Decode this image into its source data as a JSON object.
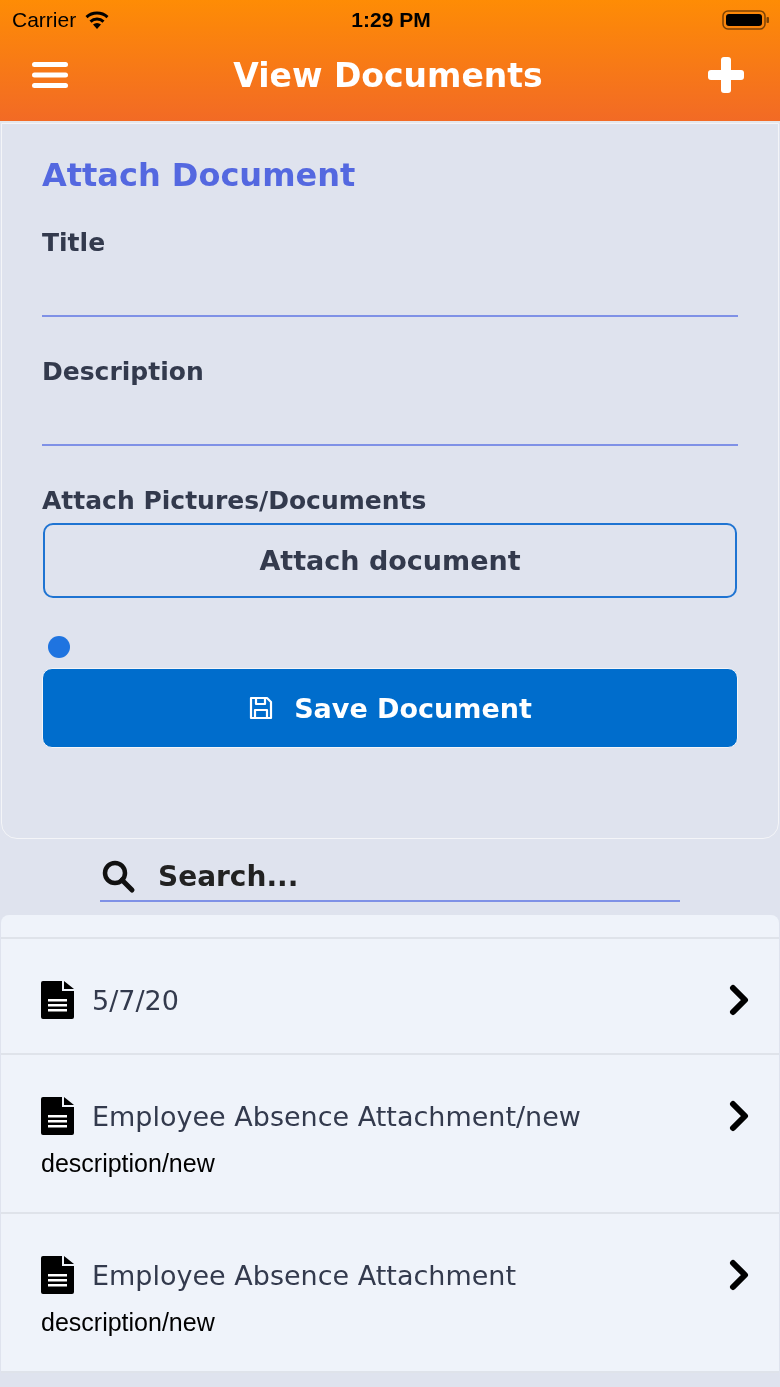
{
  "status_bar": {
    "carrier": "Carrier",
    "time": "1:29 PM"
  },
  "header": {
    "title": "View Documents"
  },
  "form": {
    "heading": "Attach Document",
    "fields": [
      {
        "label": "Title"
      },
      {
        "label": "Description"
      }
    ],
    "attach_label": "Attach Pictures/Documents",
    "attach_button": "Attach document",
    "save_button": "Save Document"
  },
  "search": {
    "placeholder": "Search..."
  },
  "documents": [
    {
      "title": "5/7/20"
    },
    {
      "title": "Employee Absence Attachment/new",
      "description": "description/new"
    },
    {
      "title": "Employee Absence Attachment",
      "description": "description/new"
    }
  ]
}
